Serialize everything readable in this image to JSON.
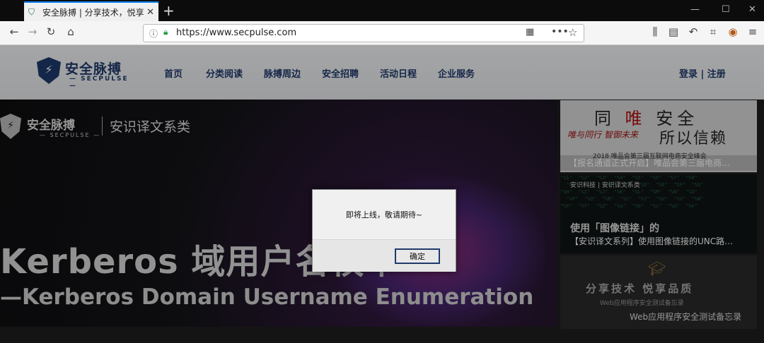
{
  "browser": {
    "tab_title": "安全脉搏 | 分享技术，悦享品质",
    "tab_close": "✕",
    "new_tab": "+",
    "window_controls": [
      "—",
      "☐",
      "✕"
    ],
    "url": "https://www.secpulse.com",
    "icons": [
      "back-icon",
      "forward-icon",
      "reload-icon",
      "home-icon",
      "library-icon",
      "sidebar-icon",
      "undo-icon",
      "crop-icon",
      "extension-icon",
      "menu-icon"
    ]
  },
  "site": {
    "logo_cn": "安全脉搏",
    "logo_en": "— SECPULSE —",
    "nav": [
      "首页",
      "分类阅读",
      "脉搏周边",
      "安全招聘",
      "活动日程",
      "企业服务"
    ],
    "login": "登录 | 注册"
  },
  "hero": {
    "logo_cn": "安全脉搏",
    "logo_en": "— SECPULSE —",
    "logo_sub": "安识译文系类",
    "title": "Kerberos 域用户名枚举",
    "subtitle": "—Kerberos Domain Username Enumeration"
  },
  "side": {
    "card1": {
      "line1_a": "同",
      "line1_b": "唯",
      "line1_c": "安全",
      "line2": "唯与同行 智御未来",
      "line2b": "所以信赖",
      "footer": "2018 唯品会第三届互联网电商安全峰会",
      "caption": "【报名通道正式开启】唯品会第三届电商…"
    },
    "card2": {
      "head": "安识科技 | 安识译文系类",
      "title": "使用「图像链接」的",
      "caption": "【安识译文系列】使用图像链接的UNC路…"
    },
    "card3": {
      "main": "分享技术 悦享品质",
      "sub": "Web应用程序安全测试备忘录",
      "caption": "Web应用程序安全测试备忘录"
    }
  },
  "dialog": {
    "message": "即将上线，敬请期待~",
    "ok_label": "确定"
  }
}
